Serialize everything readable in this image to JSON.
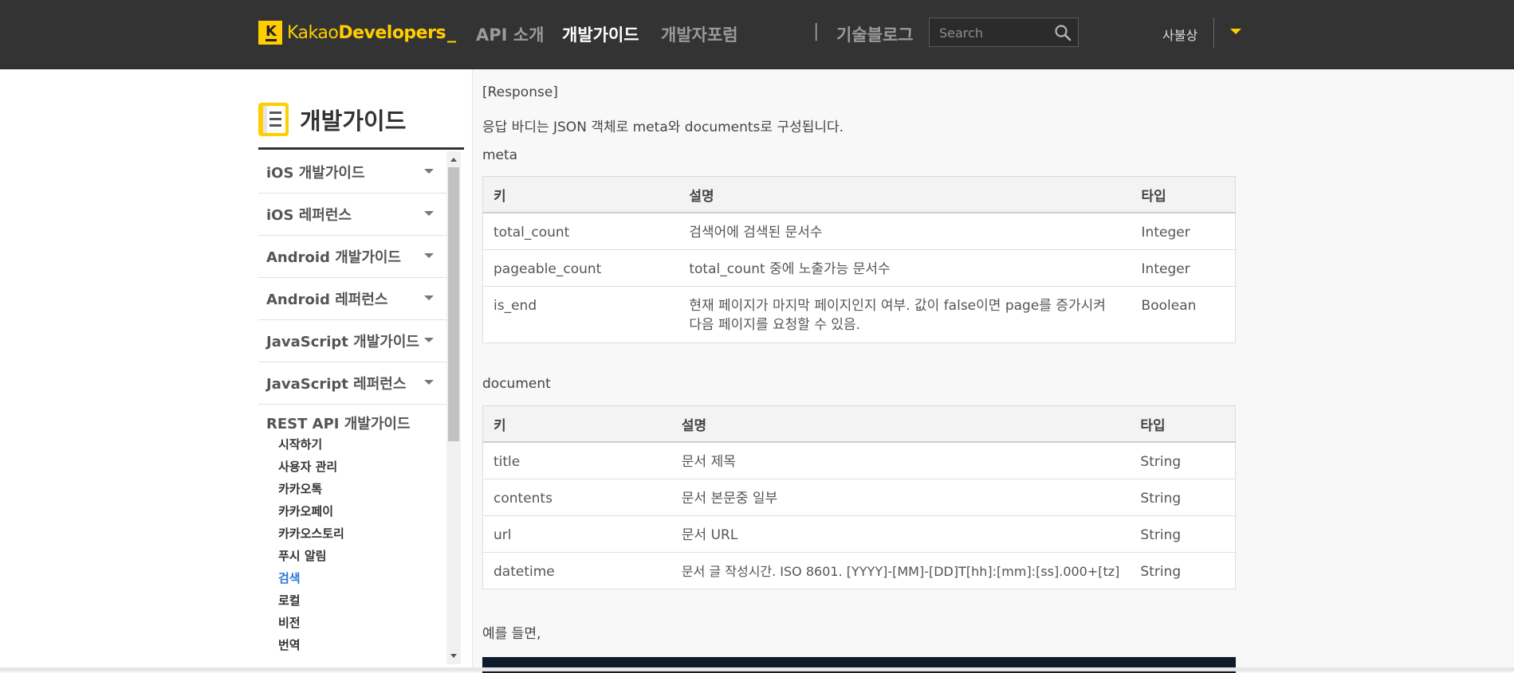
{
  "header": {
    "logo_k": "K",
    "logo_kakao": "Kakao",
    "logo_developers": "Developers",
    "logo_cursor": "_",
    "nav": [
      {
        "label": "API 소개",
        "active": false
      },
      {
        "label": "개발가이드",
        "active": true
      },
      {
        "label": "개발자포럼",
        "active": false
      }
    ],
    "separator": "|",
    "blog": "기술블로그",
    "search_placeholder": "Search",
    "user": "사불상"
  },
  "sidebar": {
    "title": "개발가이드",
    "items": [
      {
        "label": "iOS 개발가이드"
      },
      {
        "label": "iOS 레퍼런스"
      },
      {
        "label": "Android 개발가이드"
      },
      {
        "label": "Android 레퍼런스"
      },
      {
        "label": "JavaScript 개발가이드"
      },
      {
        "label": "JavaScript 레퍼런스"
      }
    ],
    "expanded_section": "REST API 개발가이드",
    "sub_items": [
      {
        "label": "시작하기",
        "current": false
      },
      {
        "label": "사용자 관리",
        "current": false
      },
      {
        "label": "카카오톡",
        "current": false
      },
      {
        "label": "카카오페이",
        "current": false
      },
      {
        "label": "카카오스토리",
        "current": false
      },
      {
        "label": "푸시 알림",
        "current": false
      },
      {
        "label": "검색",
        "current": true
      },
      {
        "label": "로컬",
        "current": false
      },
      {
        "label": "비전",
        "current": false
      },
      {
        "label": "번역",
        "current": false
      }
    ]
  },
  "content": {
    "response_heading": "[Response]",
    "intro": "응답 바디는 JSON 객체로 meta와 documents로 구성됩니다.",
    "meta_label": "meta",
    "meta_table": {
      "headers": [
        "키",
        "설명",
        "타입"
      ],
      "rows": [
        [
          "total_count",
          "검색어에 검색된 문서수",
          "Integer"
        ],
        [
          "pageable_count",
          "total_count 중에 노출가능 문서수",
          "Integer"
        ],
        [
          "is_end",
          "현재 페이지가 마지막 페이지인지 여부. 값이 false이면 page를 증가시켜 다음 페이지를 요청할 수 있음.",
          "Boolean"
        ]
      ]
    },
    "document_label": "document",
    "document_table": {
      "headers": [
        "키",
        "설명",
        "타입"
      ],
      "rows": [
        [
          "title",
          "문서 제목",
          "String"
        ],
        [
          "contents",
          "문서 본문중 일부",
          "String"
        ],
        [
          "url",
          "문서 URL",
          "String"
        ],
        [
          "datetime",
          "문서 글 작성시간. ISO 8601. [YYYY]-[MM]-[DD]T[hh]:[mm]:[ss].000+[tz]",
          "String"
        ]
      ]
    },
    "example_label": "예를 들면,"
  },
  "colors": {
    "header_bg": "#333333",
    "brand_yellow": "#ffcd00",
    "link_blue": "#2b78d6",
    "code_bg": "#0f1b2b"
  }
}
